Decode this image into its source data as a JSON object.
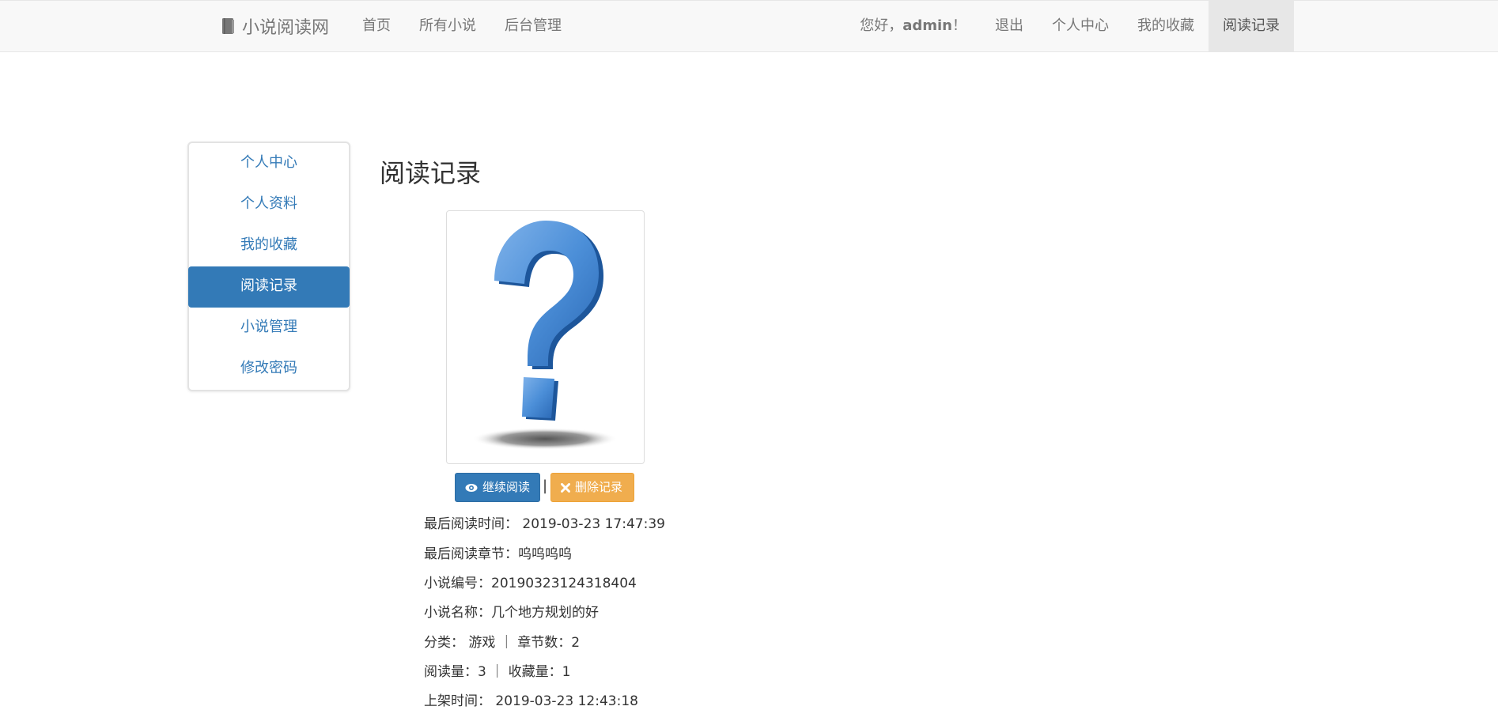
{
  "brand": {
    "name": "小说阅读网",
    "icon": "book-icon"
  },
  "nav_left": [
    "首页",
    "所有小说",
    "后台管理"
  ],
  "nav_right": {
    "greeting_prefix": "您好，",
    "username": "admin",
    "greeting_suffix": "！",
    "items": [
      "退出",
      "个人中心",
      "我的收藏",
      "阅读记录"
    ],
    "active": "阅读记录"
  },
  "sidebar": {
    "items": [
      "个人中心",
      "个人资料",
      "我的收藏",
      "阅读记录",
      "小说管理",
      "修改密码"
    ],
    "active": "阅读记录"
  },
  "page": {
    "title": "阅读记录"
  },
  "record": {
    "continue_label": "继续阅读",
    "delete_label": "删除记录",
    "separator": "|",
    "last_read_time": "最后阅读时间： 2019-03-23 17:47:39",
    "last_chapter": "最后阅读章节：呜呜呜呜",
    "novel_id": "小说编号：20190323124318404",
    "novel_name": "小说名称：几个地方规划的好",
    "category_chapters": "分类： 游戏 ｜ 章节数：2",
    "reads_favs": "阅读量：3 ｜ 收藏量：1",
    "publish_time": "上架时间： 2019-03-23 12:43:18"
  },
  "colors": {
    "primary": "#337ab7",
    "warning": "#f0ad4e",
    "navbar": "#f8f8f8"
  }
}
